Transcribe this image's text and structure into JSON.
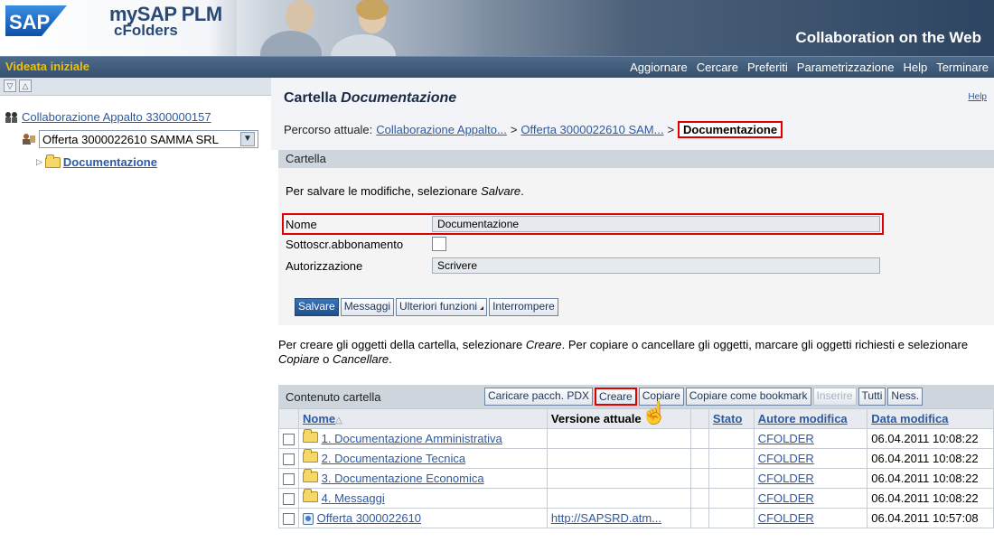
{
  "header": {
    "logo_text": "SAP",
    "product_line1": "mySAP PLM",
    "product_line2": "cFolders",
    "tagline": "Collaboration on the Web"
  },
  "nav": {
    "home": "Videata iniziale",
    "links": [
      "Aggiornare",
      "Cercare",
      "Preferiti",
      "Parametrizzazione",
      "Help",
      "Terminare"
    ]
  },
  "tree": {
    "toolbar_icons": [
      "expand-all-icon",
      "collapse-all-icon"
    ],
    "root_label": "Collaborazione Appalto 3300000157",
    "offer_select": "Offerta 3000022610 SAMMA SRL",
    "folder_label": "Documentazione"
  },
  "main": {
    "title_prefix": "Cartella",
    "title_name": "Documentazione",
    "help": "Help",
    "breadcrumb": {
      "label": "Percorso attuale:",
      "items": [
        "Collaborazione Appalto...",
        "Offerta 3000022610 SAM...",
        "Documentazione"
      ],
      "separator": ">"
    },
    "panel_title": "Cartella",
    "info_prefix": "Per salvare le modifiche, selezionare",
    "info_action": "Salvare",
    "info_suffix": ".",
    "form": {
      "nome_label": "Nome",
      "nome_value": "Documentazione",
      "abbonamento_label": "Sottoscr.abbonamento",
      "autorizzazione_label": "Autorizzazione",
      "autorizzazione_value": "Scrivere"
    },
    "buttons": {
      "save": "Salvare",
      "messages": "Messaggi",
      "more": "Ulteriori funzioni",
      "cancel": "Interrompere"
    },
    "info2": {
      "p1": "Per creare gli oggetti della cartella, selezionare ",
      "creare": "Creare",
      "p2": ". Per copiare o cancellare gli oggetti, marcare gli oggetti richiesti e selezionare ",
      "copiare": "Copiare",
      "o": " o ",
      "cancellare": "Cancellare",
      "end": "."
    },
    "table": {
      "title": "Contenuto cartella",
      "buttons": {
        "upload": "Caricare pacch. PDX",
        "create": "Creare",
        "copy": "Copiare",
        "bookmark": "Copiare come bookmark",
        "insert": "Inserire",
        "all": "Tutti",
        "none": "Ness."
      },
      "columns": {
        "nome": "Nome",
        "sort_indicator": "△",
        "versione": "Versione attuale",
        "stato": "Stato",
        "autore": "Autore modifica",
        "data": "Data modifica"
      },
      "rows": [
        {
          "name": "1. Documentazione Amministrativa",
          "version": "",
          "stato": "",
          "autore": "CFOLDER",
          "data": "06.04.2011 10:08:22",
          "icon": "folder-icon"
        },
        {
          "name": "2. Documentazione Tecnica",
          "version": "",
          "stato": "",
          "autore": "CFOLDER",
          "data": "06.04.2011 10:08:22",
          "icon": "folder-icon"
        },
        {
          "name": "3. Documentazione Economica",
          "version": "",
          "stato": "",
          "autore": "CFOLDER",
          "data": "06.04.2011 10:08:22",
          "icon": "folder-icon"
        },
        {
          "name": "4. Messaggi",
          "version": "",
          "stato": "",
          "autore": "CFOLDER",
          "data": "06.04.2011 10:08:22",
          "icon": "folder-icon"
        },
        {
          "name": "Offerta 3000022610",
          "version": "http://SAPSRD.atm...",
          "stato": "",
          "autore": "CFOLDER",
          "data": "06.04.2011 10:57:08",
          "icon": "document-icon"
        }
      ]
    }
  },
  "colors": {
    "highlight": "#e00000",
    "nav_bg": "#3d5a7a",
    "home_link": "#f0c000",
    "link": "#2b5aa5",
    "primary_button": "#1f4f8a"
  }
}
